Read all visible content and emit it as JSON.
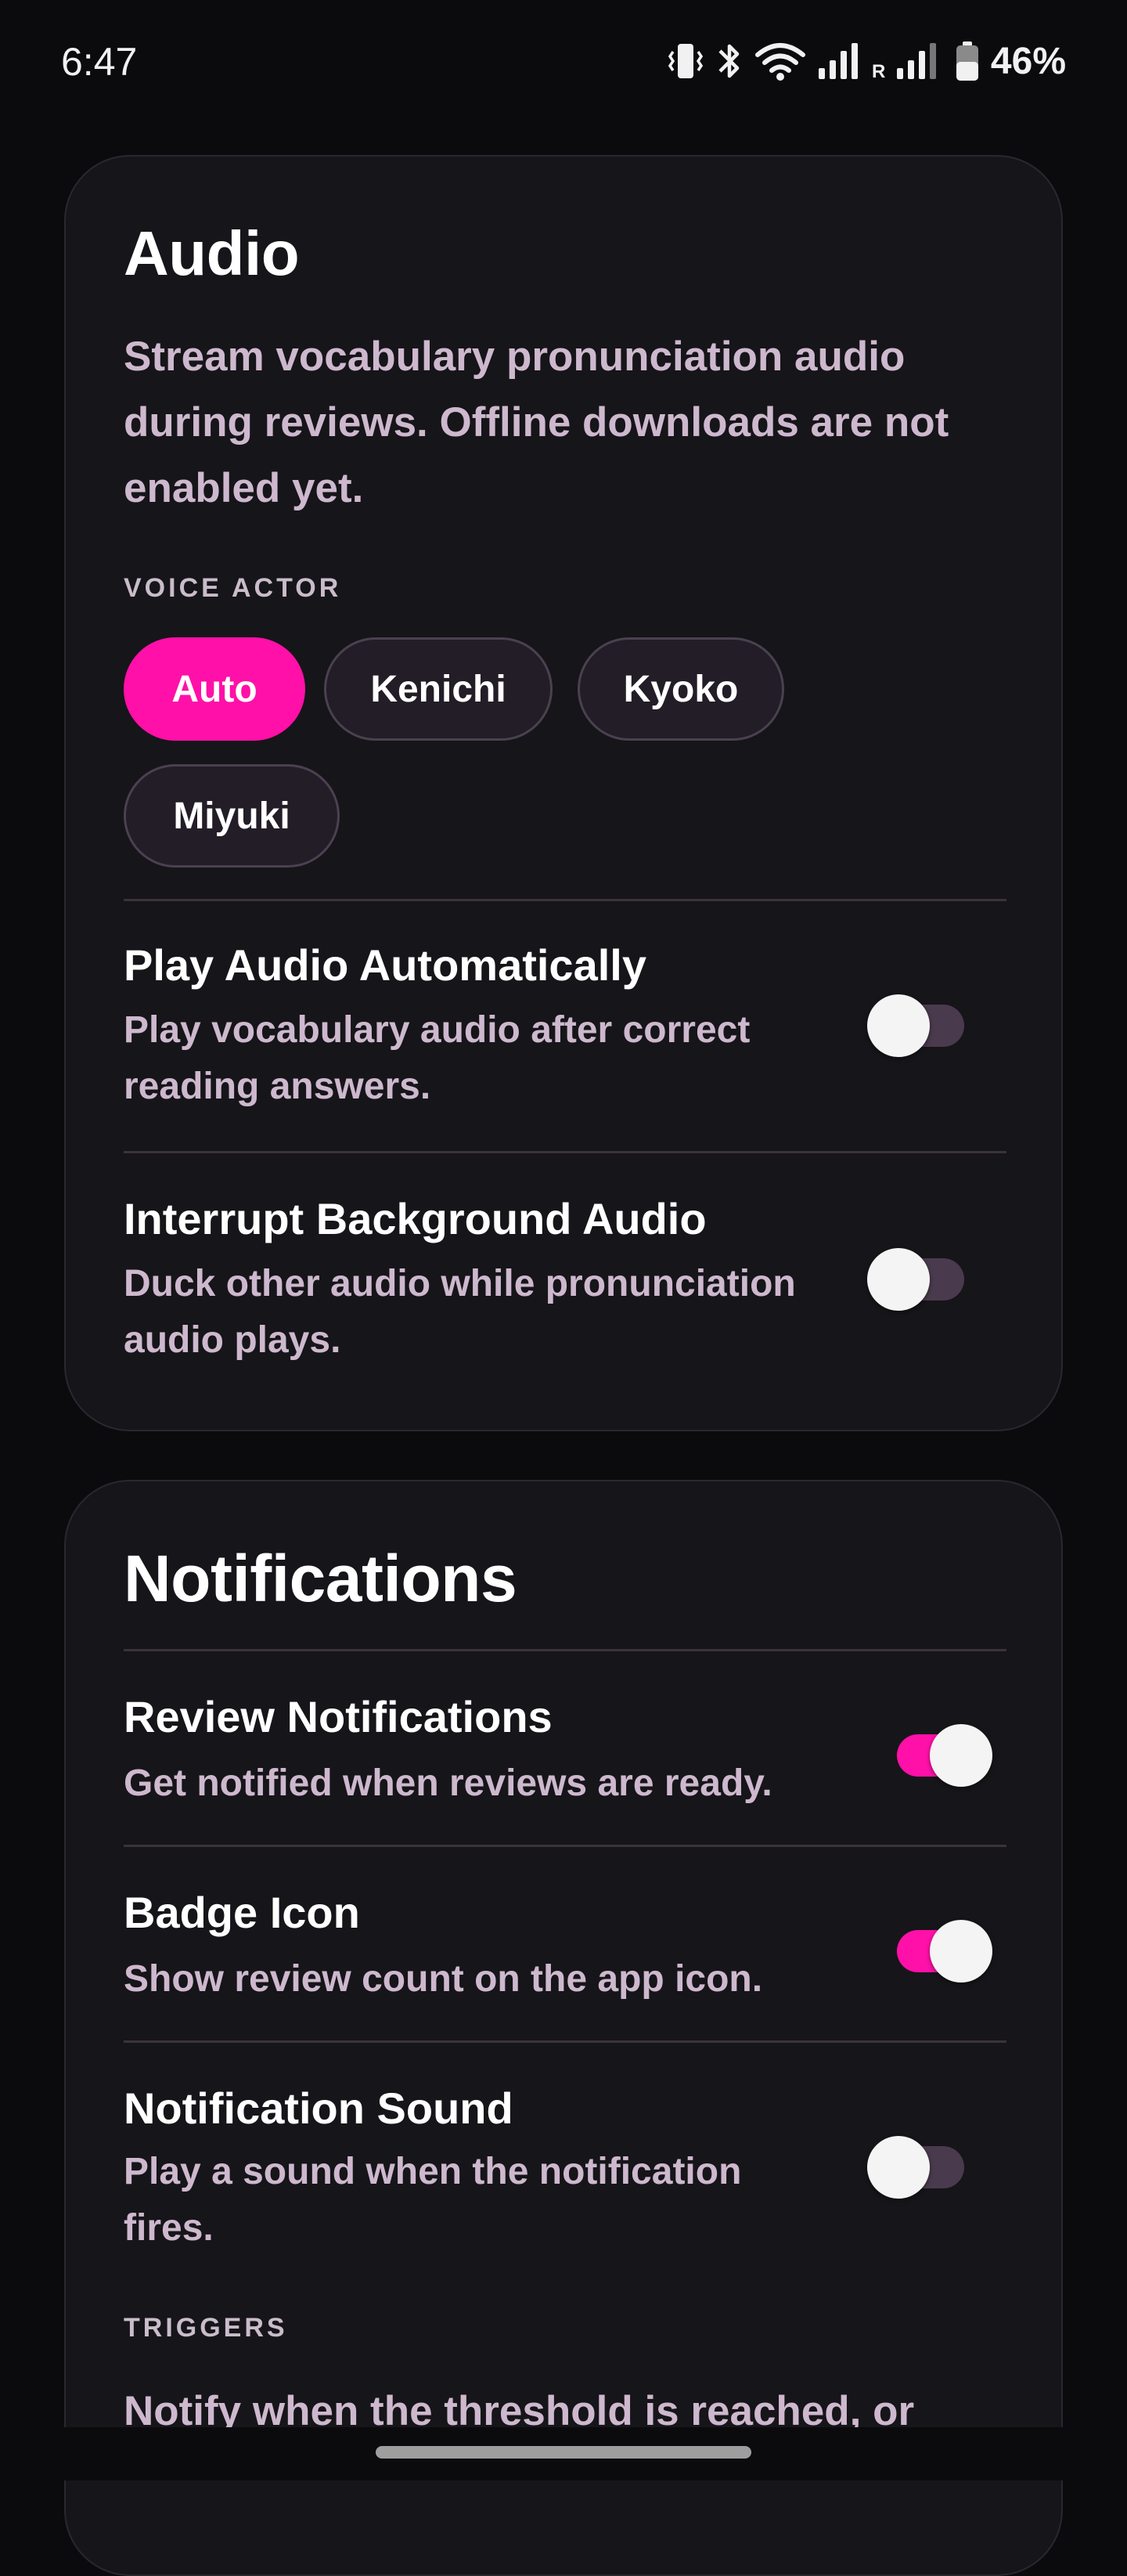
{
  "status_bar": {
    "time": "6:47",
    "battery": "46%",
    "roaming_label": "R",
    "icons": [
      "vibrate-icon",
      "bluetooth-icon",
      "wifi-icon",
      "signal-icon",
      "signal-roaming-icon",
      "battery-icon"
    ]
  },
  "audio": {
    "title": "Audio",
    "description": "Stream vocabulary pronunciation audio during reviews. Offline downloads are not enabled yet.",
    "voice_actor_label": "VOICE ACTOR",
    "voice_actors": [
      "Auto",
      "Kenichi",
      "Kyoko",
      "Miyuki"
    ],
    "selected_voice_actor": "Auto",
    "settings": [
      {
        "title": "Play Audio Automatically",
        "subtitle": "Play vocabulary audio after correct reading answers.",
        "enabled": false
      },
      {
        "title": "Interrupt Background Audio",
        "subtitle": "Duck other audio while pronunciation audio plays.",
        "enabled": false
      }
    ]
  },
  "notifications": {
    "title": "Notifications",
    "settings": [
      {
        "title": "Review Notifications",
        "subtitle": "Get notified when reviews are ready.",
        "enabled": true
      },
      {
        "title": "Badge Icon",
        "subtitle": "Show review count on the app icon.",
        "enabled": true
      },
      {
        "title": "Notification Sound",
        "subtitle": "Play a sound when the notification fires.",
        "enabled": false
      }
    ],
    "triggers_label": "TRIGGERS",
    "triggers_description": "Notify when the threshold is reached, or"
  },
  "colors": {
    "accent": "#ff10a8",
    "background": "#0b0b0e",
    "card": "#161519",
    "secondary_text": "#cdb8ce"
  }
}
